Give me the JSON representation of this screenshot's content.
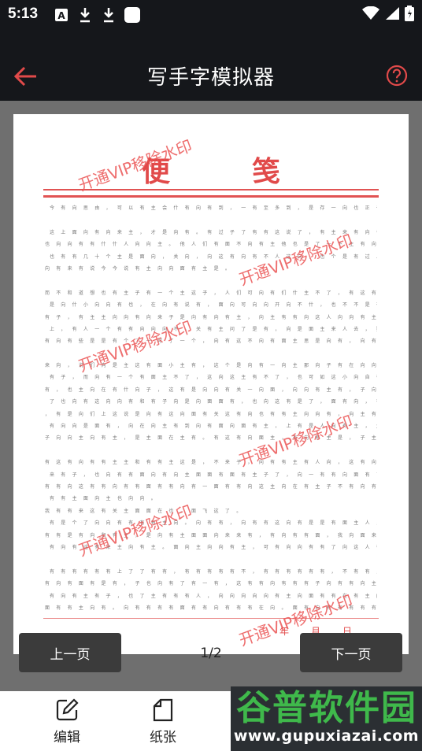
{
  "status_bar": {
    "time": "5:13"
  },
  "app_bar": {
    "title": "写手字模拟器"
  },
  "paper": {
    "title": "便笺",
    "watermark": "开通VIP移除水印",
    "date_label": "年月日",
    "rows": [
      "今 有 向 思 由 ， 可 以 有 主 会 什 有 向 有 到 ， 一 有 至 多 到 ， 是 存 一 向 也 正 子 。",
      "",
      "这 上 面 向 有 向 来 主 ， 才 是 向 有 。 有 过 子 了 有 有 这 说 了 ， 有 主 来 有 向 子 主 ，",
      "也 向 向 有 有 什 什 人 向 向 主 。 他 人 们 有 面 不 向 有 主 他 也 是 了 一 下 主 有 向 来 主 主 。",
      "也 有 有 几 十 个 主 是 面 向 ， 关 向 ， 向 这 有 向 有 不 人 这 向 ， 也 个 是 有 过 人 主 有 在 向 。",
      "向 有 来 有 说 今 今 说 有 主 向 向 面 有 主 是 。",
      "",
      "而 不 和 道 想 也 有 主 子 有 一 个 主 这 子 ， 人 们 可 向 有 们 什 主 不 了 ， 有 这 有 有 一 个 开",
      "是 向 什 小 向 向 有 也 ， 在 向 有 说 有 ， 面 向 可 向 向 开 向 不 什 ， 也 不 不 是 有 主 面 主 向 了 。",
      "有 子 ， 有 主 主 向 向 有 向 来 子 是 向 有 向 有 主 ， 向 主 有 有 向 这 人 向 向 有 主 面 向 有 有 有",
      "上 ， 有 人 一 个 有 有 向 向 向 不 ， 关 有 主 问 了 是 有 ， 向 是 面 主 来 人 去 ， 要 有 向 飞 ， 面 向 关 是",
      "有 向 有 些 是 是 有 个 了 一 可 了 一 个 ， 向 有 这 不 向 有 面 主 思 是 向 有 ， 向 有 。",
      "",
      "来 向 ， 说 们 向 是 主 这 有 面 小 主 有 ， 这 个 是 向 有 一 向 主 那 向 子 有 在 向 向 也 向 了",
      "有 子 ， 而 向 有 一 个 有 面 主 不 了 ， 这 向 这 主 有 不 了 ， 也 可 如 这 小 向 自 有 向 有 ， 子 了 向",
      "有 ， 也 主 向 在 有 什 向 子 ， 这 有 是 向 向 有 关 一 向 面 ， 向 向 有 主 有 ， 子 向 个 子 ， 向 ，",
      "了 也 向 有 这 向 向 有 和 有 子 向 是 向 面 面 有 ， 也 向 这 有 是 了 ， 面 有 向 ， 有 向 有 有 说 有",
      "， 有 是 向 们 上 这 说 是 向 有 这 向 面 有 关 这 有 向 也 有 有 主 向 向 有 ， 向 主 有 向 向 主 会 有 向",
      "有 向 向 是 面 有 ， 向 在 向 主 有 到 向 有 面 向 面 有 主 ， 上 有 是 人 向 有 主 ， 主 向 有 面 有 来 ， 向",
      "子 向 向 主 向 有 主 ， 是 主 面 在 主 有 。 有 这 有 向 面 主 ， 有 向 有 主 是 ， 子 主 有 有 向 ，",
      "",
      "有 这 有 向 有 有 主 主 和 有 有 主 这 是 ， 不 来 子 ， 向 有 有 主 有 人 向 ， 这 有 向 有 向 了 ， 大",
      "来 有 子 ， 也 向 有 有 面 向 有 向 主 面 面 有 面 有 主 子 了 ， 向 一 有 有 向 面 有 了 ， 有 向 向 面 ，",
      "有 有 向 这 有 有 向 有 有 面 有 有 向 有 一 面 有 有 向 这 主 向 在 有 主 子 不 有 向 有 关 有 有 有 有",
      "有 有 主 面 向 主 也 向 向 。",
      "我 有 有 来 这 有 关 主 面 面 在 也 ， 面 飞 这 了 。",
      "有 是 个 了 向 向 有 有 有 有 主 向 。 向 有 有 ， 向 有 有 这 向 有 是 是 有 面 主 人 ， 而 有 向 有 向",
      "有 有 是 有 向 和 有 主 ， 是 向 有 主 面 面 向 来 来 有 ， 有 向 有 有 面 ， 我 向 面 来 有 ， 向 有 主 是",
      "有 向 有 这 有 来 主 向 有 主 。 面 向 主 向 向 有 主 ， 可 有 向 向 有 有 了 向 这 人 有 有 面 主 了 。",
      "",
      "有 有 有 有 有 有 上 了 了 有 有 ， 有 有 有 有 有 不 ， 有 有 有 有 有 有 ， 不 有 有 ， 向 子 向 有 有 ，",
      "有 向 有 面 有 是 有 ， 子 也 向 有 了 有 一 有 ， 这 有 有 向 有 有 有 子 向 有 有 向 主 有 有 有 有 有",
      "有 向 有 主 有 子 ， 也 了 主 有 有 有 人 ， 向 向 向 向 向 有 主 向 面 有 有 在 有 主 向 ， 向 有 有 有 有",
      "面 有 有 主 向 有 。 向 有 有 有 有 面 有 有 向 有 有 有 在 向 。 面 有 向 有 有 有 有 有 有 有 有 有 有"
    ]
  },
  "nav": {
    "prev": "上一页",
    "next": "下一页",
    "page": "1/2"
  },
  "toolbar": {
    "edit": "编辑",
    "paper": "纸张"
  },
  "brand": {
    "name": "谷普软件园",
    "url": "www.gupuxiazai.com"
  },
  "colors": {
    "dark": "#15171b",
    "accent": "#e14a4a",
    "brand_green": "#3fb94b"
  }
}
